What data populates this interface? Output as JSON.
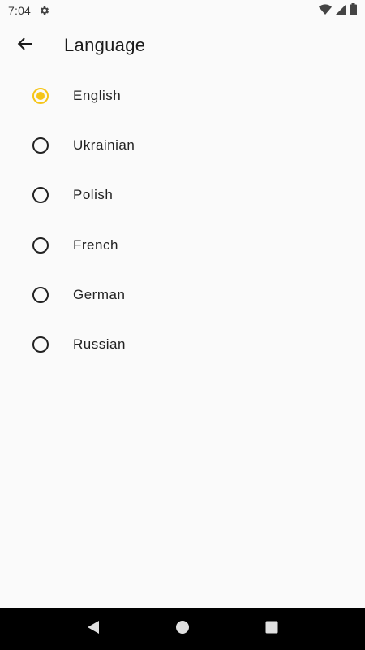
{
  "status_bar": {
    "time": "7:04",
    "icons": [
      "gear-icon",
      "wifi-icon",
      "signal-icon",
      "battery-icon"
    ]
  },
  "app_bar": {
    "back_icon": "arrow-back-icon",
    "title": "Language"
  },
  "languages": {
    "selected": "English",
    "accent_color": "#f5c518",
    "options": [
      {
        "label": "English",
        "selected": true
      },
      {
        "label": "Ukrainian",
        "selected": false
      },
      {
        "label": "Polish",
        "selected": false
      },
      {
        "label": "French",
        "selected": false
      },
      {
        "label": "German",
        "selected": false
      },
      {
        "label": "Russian",
        "selected": false
      }
    ]
  },
  "nav_bar": {
    "buttons": [
      "back-triangle-icon",
      "home-circle-icon",
      "recents-square-icon"
    ]
  }
}
